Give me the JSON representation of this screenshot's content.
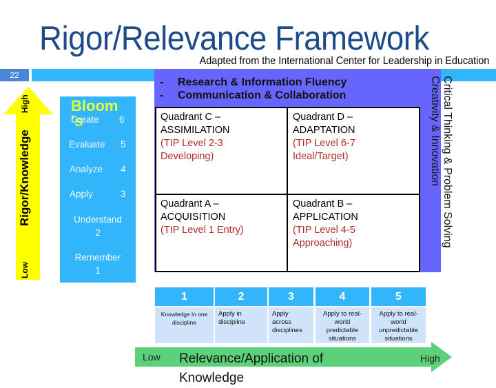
{
  "slide": {
    "title": "Rigor/Relevance Framework",
    "subtitle": "Adapted from the International Center for Leadership in Education",
    "number": "22"
  },
  "rigor_axis": {
    "label": "Rigor/Knowledge",
    "high": "High",
    "low": "Low",
    "color": "#ffff00"
  },
  "bloom": {
    "title": "Bloom's",
    "title_line1": "Bloom",
    "title_line2": "'s",
    "levels": [
      {
        "name": "Create",
        "number": "6"
      },
      {
        "name": "Evaluate",
        "number": "5"
      },
      {
        "name": "Analyze",
        "number": "4"
      },
      {
        "name": "Apply",
        "number": "3"
      },
      {
        "name": "Understand",
        "number": "2"
      },
      {
        "name": "Remember",
        "number": "1"
      }
    ],
    "color": "#33b5fb"
  },
  "skills": {
    "top": [
      {
        "bullet": "-",
        "text": "Research & Information Fluency"
      },
      {
        "bullet": "-",
        "text": "Communication & Collaboration"
      }
    ],
    "side": [
      "Critical Thinking & Problem Solving",
      "Creativity & Innovation"
    ],
    "color": "#6666ff"
  },
  "quadrants": {
    "C": {
      "title1": "Quadrant C –",
      "title2": "ASSIMILATION",
      "tip1": "(TIP Level 2-3",
      "tip2": "Developing)"
    },
    "D": {
      "title1": "Quadrant D –",
      "title2": "ADAPTATION",
      "tip1": "(TIP Level 6-7",
      "tip2": "Ideal/Target)"
    },
    "A": {
      "title1": "Quadrant A –",
      "title2": "ACQUISITION",
      "tip1": "(TIP Level 1 Entry)",
      "tip2": ""
    },
    "B": {
      "title1": "Quadrant B –",
      "title2": "APPLICATION",
      "tip1": "(TIP Level 4-5",
      "tip2": "Approaching)"
    }
  },
  "relevance_levels": [
    {
      "number": "1",
      "description": "Knowledge in one discipline"
    },
    {
      "number": "2",
      "description": "Apply in discipline"
    },
    {
      "number": "3",
      "description": "Apply across disciplines"
    },
    {
      "number": "4",
      "description": "Apply to real-world predictable situations"
    },
    {
      "number": "5",
      "description": "Apply to real-world unpredictable situations"
    }
  ],
  "relevance_axis": {
    "low": "Low",
    "label": "Relevance/Application of Knowledge",
    "high": "High",
    "color": "#5dd07a"
  }
}
